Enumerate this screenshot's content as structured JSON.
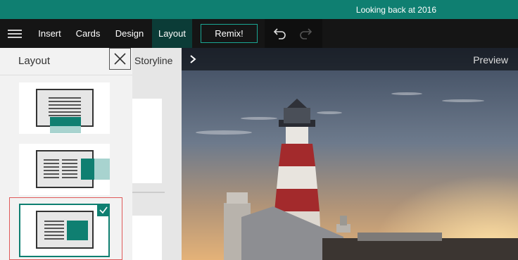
{
  "titlebar": {
    "title": "Looking back at 2016"
  },
  "toolbar": {
    "menu_icon": "hamburger-icon",
    "tabs": [
      {
        "label": "Insert"
      },
      {
        "label": "Cards"
      },
      {
        "label": "Design"
      },
      {
        "label": "Layout",
        "active": true
      }
    ],
    "remix_label": "Remix!",
    "undo_icon": "undo-icon",
    "redo_icon": "redo-icon"
  },
  "layout_panel": {
    "title": "Layout",
    "close_icon": "close-icon",
    "selected_index": 2,
    "options": [
      {
        "name": "layout-text-top-accent"
      },
      {
        "name": "layout-two-column-side-accent"
      },
      {
        "name": "layout-text-image-inside"
      }
    ]
  },
  "storyline": {
    "label": "Storyline"
  },
  "preview": {
    "label": "Preview",
    "expand_icon": "chevron-right-icon"
  },
  "colors": {
    "accent": "#0f7f71",
    "selection_border": "#e05a5a"
  }
}
